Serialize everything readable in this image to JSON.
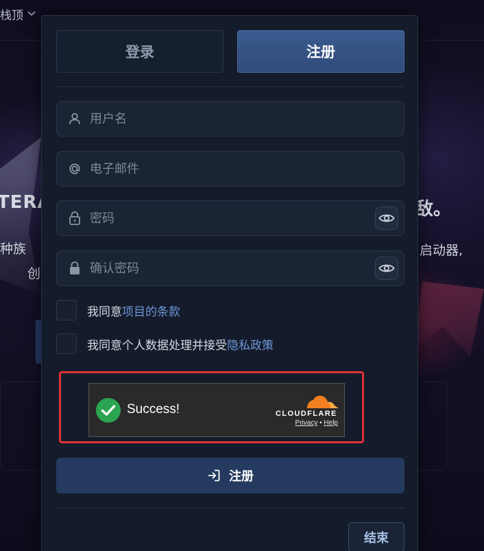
{
  "background": {
    "nav_label": "栈顶",
    "headline_left": "TERA",
    "headline_right": "敌。",
    "sub_left_1": "种族",
    "sub_left_2": "创",
    "sub_right": "启动器,"
  },
  "tabs": {
    "login": "登录",
    "register": "注册"
  },
  "form": {
    "username_placeholder": "用户名",
    "email_placeholder": "电子邮件",
    "password_placeholder": "密码",
    "confirm_password_placeholder": "确认密码"
  },
  "agreements": {
    "terms_prefix": "我同意",
    "terms_link": "项目的条款",
    "privacy_prefix": "我同意个人数据处理并接受",
    "privacy_link": "隐私政策"
  },
  "captcha": {
    "status": "Success!",
    "brand": "CLOUDFLARE",
    "privacy": "Privacy",
    "separator": "•",
    "help": "Help",
    "colors": {
      "success_green": "#2ca552",
      "cloud_orange": "#f38020",
      "highlight_red": "#e03236"
    }
  },
  "actions": {
    "register_button": "注册",
    "end_button": "结束"
  }
}
